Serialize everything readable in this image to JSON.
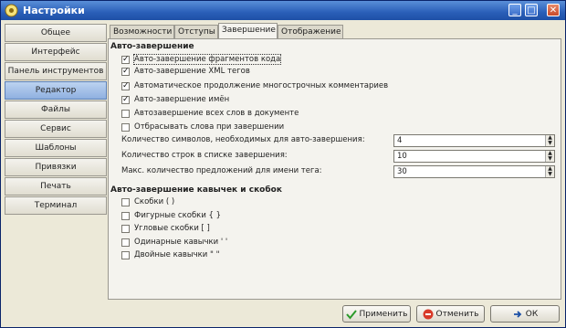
{
  "window": {
    "title": "Настройки"
  },
  "sidebar": {
    "items": [
      {
        "label": "Общее"
      },
      {
        "label": "Интерфейс"
      },
      {
        "label": "Панель инструментов"
      },
      {
        "label": "Редактор"
      },
      {
        "label": "Файлы"
      },
      {
        "label": "Сервис"
      },
      {
        "label": "Шаблоны"
      },
      {
        "label": "Привязки"
      },
      {
        "label": "Печать"
      },
      {
        "label": "Терминал"
      }
    ],
    "active": "Редактор"
  },
  "tabs": [
    {
      "label": "Возможности"
    },
    {
      "label": "Отступы"
    },
    {
      "label": "Завершение"
    },
    {
      "label": "Отображение"
    }
  ],
  "autocomplete": {
    "title": "Авто-завершение",
    "options": [
      {
        "label": "Авто-завершение фрагментов кода",
        "checked": true
      },
      {
        "label": "Авто-завершение XML тегов",
        "checked": true
      },
      {
        "label": "Автоматическое продолжение многострочных комментариев",
        "checked": true
      },
      {
        "label": "Авто-завершение имён",
        "checked": true
      },
      {
        "label": "Автозавершение всех слов в документе",
        "checked": false
      },
      {
        "label": "Отбрасывать слова при завершении",
        "checked": false
      }
    ],
    "fields": [
      {
        "label": "Количество символов, необходимых для авто-завершения:",
        "value": "4"
      },
      {
        "label": "Количество строк в списке завершения:",
        "value": "10"
      },
      {
        "label": "Макс. количество предложений для имени тега:",
        "value": "30"
      }
    ]
  },
  "quotes": {
    "title": "Авто-завершение кавычек и скобок",
    "options": [
      {
        "label": "Скобки ( )",
        "checked": false
      },
      {
        "label": "Фигурные скобки { }",
        "checked": false
      },
      {
        "label": "Угловые скобки [ ]",
        "checked": false
      },
      {
        "label": "Одинарные кавычки ' '",
        "checked": false
      },
      {
        "label": "Двойные кавычки \" \"",
        "checked": false
      }
    ]
  },
  "buttons": {
    "apply": "Применить",
    "cancel": "Отменить",
    "ok": "ОК"
  }
}
